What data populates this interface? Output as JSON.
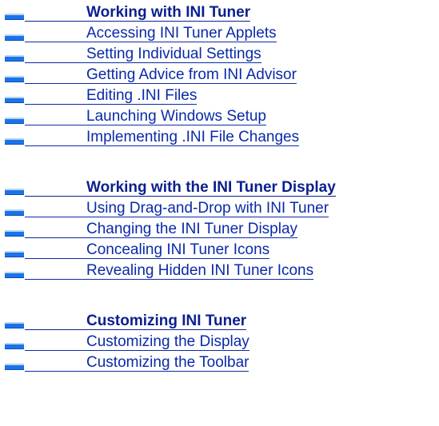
{
  "sections": [
    {
      "heading": "Working with INI Tuner",
      "items": [
        "Accessing INI Tuner Applets",
        "Setting Individual Settings",
        "Getting Advice from INI Advisor",
        "Editing .INI Files",
        "Launching Windows Setup",
        "Implementing .INI File Changes"
      ]
    },
    {
      "heading": "Working with the INI Tuner Display",
      "items": [
        "Using Drag-and-Drop with INI Tuner",
        "Changing the INI Tuner Display",
        "Concealing INI Tuner Icons",
        "Revealing Hidden INI Tuner Icons"
      ]
    },
    {
      "heading": "Customizing INI Tuner",
      "items": [
        "Customizing the Display",
        "Customizing the Toolbar"
      ]
    }
  ],
  "colors": {
    "link": "#0a2aa8",
    "chip": "#1a73e8"
  },
  "icons": {
    "bullet": "topic-chip-icon"
  }
}
